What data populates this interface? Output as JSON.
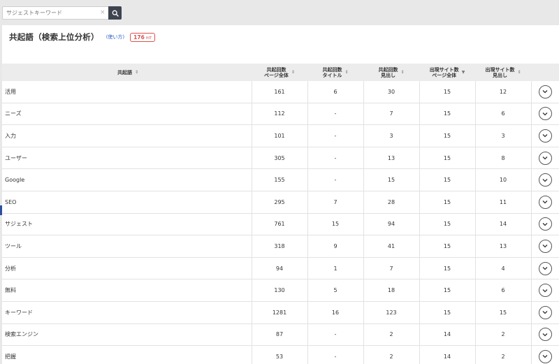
{
  "search": {
    "placeholder": "サジェストキーワード",
    "clear_icon": "×",
    "button_icon": "search-icon"
  },
  "header": {
    "title": "共起語（検索上位分析）",
    "howto_link": "(使い方)",
    "hit_count": "176",
    "hit_unit": "HIT"
  },
  "table": {
    "columns": [
      {
        "label": "共起語",
        "sort": "⇕"
      },
      {
        "label": "共起回数\nページ全体",
        "sort": "⇕"
      },
      {
        "label": "共起回数\nタイトル",
        "sort": "⇕"
      },
      {
        "label": "共起回数\n見出し",
        "sort": "⇕"
      },
      {
        "label": "出現サイト数\nページ全体",
        "sort": "▼"
      },
      {
        "label": "出現サイト数\n見出し",
        "sort": "⇕"
      }
    ],
    "rows": [
      {
        "word": "活用",
        "page": "161",
        "title": "6",
        "heading": "30",
        "sites_page": "15",
        "sites_heading": "12"
      },
      {
        "word": "ニーズ",
        "page": "112",
        "title": "-",
        "heading": "7",
        "sites_page": "15",
        "sites_heading": "6"
      },
      {
        "word": "入力",
        "page": "101",
        "title": "-",
        "heading": "3",
        "sites_page": "15",
        "sites_heading": "3"
      },
      {
        "word": "ユーザー",
        "page": "305",
        "title": "-",
        "heading": "13",
        "sites_page": "15",
        "sites_heading": "8"
      },
      {
        "word": "Google",
        "page": "155",
        "title": "-",
        "heading": "15",
        "sites_page": "15",
        "sites_heading": "10"
      },
      {
        "word": "SEO",
        "page": "295",
        "title": "7",
        "heading": "28",
        "sites_page": "15",
        "sites_heading": "11"
      },
      {
        "word": "サジェスト",
        "page": "761",
        "title": "15",
        "heading": "94",
        "sites_page": "15",
        "sites_heading": "14"
      },
      {
        "word": "ツール",
        "page": "318",
        "title": "9",
        "heading": "41",
        "sites_page": "15",
        "sites_heading": "13"
      },
      {
        "word": "分析",
        "page": "94",
        "title": "1",
        "heading": "7",
        "sites_page": "15",
        "sites_heading": "4"
      },
      {
        "word": "無料",
        "page": "130",
        "title": "5",
        "heading": "18",
        "sites_page": "15",
        "sites_heading": "6"
      },
      {
        "word": "キーワード",
        "page": "1281",
        "title": "16",
        "heading": "123",
        "sites_page": "15",
        "sites_heading": "15"
      },
      {
        "word": "検索エンジン",
        "page": "87",
        "title": "-",
        "heading": "2",
        "sites_page": "14",
        "sites_heading": "2"
      },
      {
        "word": "把握",
        "page": "53",
        "title": "-",
        "heading": "2",
        "sites_page": "14",
        "sites_heading": "2"
      }
    ]
  }
}
